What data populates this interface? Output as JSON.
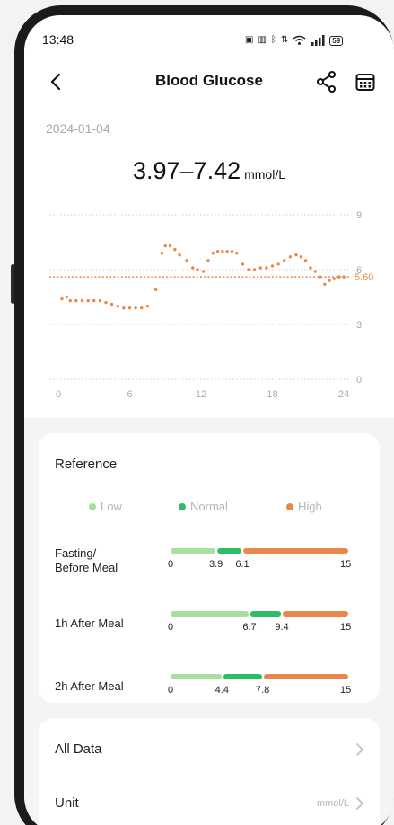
{
  "status_bar": {
    "time": "13:48",
    "icons": [
      "nfc-icon",
      "vibrate-icon",
      "bluetooth-icon",
      "data-speed-icon",
      "wifi-icon",
      "signal-icon"
    ],
    "battery": "59"
  },
  "header": {
    "title": "Blood Glucose"
  },
  "summary": {
    "date": "2024-01-04",
    "range": "3.97–7.42",
    "unit": "mmol/L"
  },
  "chart_data": {
    "type": "scatter",
    "title": "",
    "xlabel": "",
    "ylabel": "",
    "x_ticks": [
      "0",
      "6",
      "12",
      "18",
      "24"
    ],
    "y_ticks": [
      "0",
      "3",
      "6",
      "9"
    ],
    "xlim": [
      0,
      24
    ],
    "ylim": [
      0,
      9
    ],
    "grid": true,
    "reference_line": {
      "value": 5.6,
      "label": "5.60",
      "color": "#e8894a"
    },
    "color": "#e8894a",
    "series": [
      {
        "x": [
          0.3,
          0.7,
          1.0,
          1.5,
          2.0,
          2.5,
          3.0,
          3.5,
          4.0,
          4.5,
          5.0,
          5.5,
          6.0,
          6.5,
          7.0,
          7.5,
          8.2,
          8.7,
          9.0,
          9.4,
          9.8,
          10.2,
          10.8,
          11.3,
          11.7,
          12.2,
          12.6,
          13.0,
          13.4,
          13.8,
          14.2,
          14.6,
          15.0,
          15.5,
          16.0,
          16.5,
          17.0,
          17.5,
          18.0,
          18.5,
          19.0,
          19.5,
          20.0,
          20.4,
          20.8,
          21.2,
          21.6,
          22.0,
          22.4,
          22.8,
          23.2,
          23.6,
          24.0
        ],
        "y": [
          4.4,
          4.5,
          4.3,
          4.3,
          4.3,
          4.3,
          4.3,
          4.3,
          4.2,
          4.1,
          4.0,
          3.9,
          3.9,
          3.9,
          3.9,
          4.0,
          4.9,
          6.9,
          7.3,
          7.3,
          7.1,
          6.8,
          6.5,
          6.1,
          6.0,
          5.9,
          6.5,
          6.9,
          7.0,
          7.0,
          7.0,
          7.0,
          6.9,
          6.3,
          6.0,
          6.0,
          6.1,
          6.1,
          6.2,
          6.3,
          6.5,
          6.7,
          6.8,
          6.7,
          6.5,
          6.1,
          5.9,
          5.6,
          5.2,
          5.4,
          5.5,
          5.6,
          5.6
        ]
      }
    ]
  },
  "reference": {
    "title": "Reference",
    "legend": [
      {
        "label": "Low",
        "color": "#a8dea0"
      },
      {
        "label": "Normal",
        "color": "#2dbd67"
      },
      {
        "label": "High",
        "color": "#e8894a"
      }
    ],
    "rows": [
      {
        "label_line1": "Fasting/",
        "label_line2": "Before Meal",
        "min": 0,
        "max": 15,
        "low": 3.9,
        "high": 6.1,
        "ticks": [
          "0",
          "3.9",
          "6.1",
          "15"
        ]
      },
      {
        "label_line1": "1h After Meal",
        "label_line2": "",
        "min": 0,
        "max": 15,
        "low": 6.7,
        "high": 9.4,
        "ticks": [
          "0",
          "6.7",
          "9.4",
          "15"
        ]
      },
      {
        "label_line1": "2h After Meal",
        "label_line2": "",
        "min": 0,
        "max": 15,
        "low": 4.4,
        "high": 7.8,
        "ticks": [
          "0",
          "4.4",
          "7.8",
          "15"
        ]
      }
    ]
  },
  "list": {
    "items": [
      {
        "label": "All Data",
        "value": ""
      },
      {
        "label": "Unit",
        "value": "mmol/L"
      }
    ]
  }
}
